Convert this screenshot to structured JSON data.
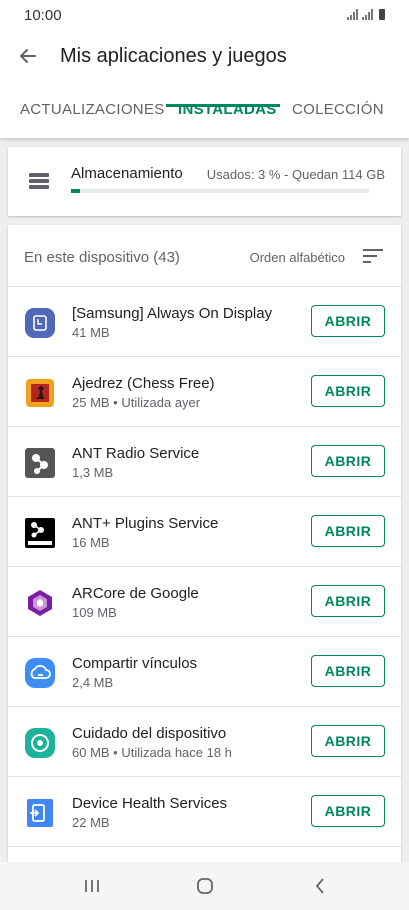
{
  "status_bar": {
    "time": "10:00"
  },
  "header": {
    "title": "Mis aplicaciones y juegos",
    "tabs": [
      {
        "label": "ACTUALIZACIONES",
        "active": false
      },
      {
        "label": "INSTALADAS",
        "active": true
      },
      {
        "label": "COLECCIÓN",
        "active": false
      }
    ]
  },
  "storage": {
    "title": "Almacenamiento",
    "usage_text": "Usados: 3 % - Quedan 114 GB",
    "used_fraction": 0.03
  },
  "list": {
    "title": "En este dispositivo (43)",
    "sort_label": "Orden alfabético",
    "button_label": "ABRIR",
    "apps": [
      {
        "name": "[Samsung] Always On Display",
        "meta": "41 MB",
        "icon": "samsung-aod-icon"
      },
      {
        "name": "Ajedrez (Chess Free)",
        "meta": "25 MB • Utilizada ayer",
        "icon": "chess-icon"
      },
      {
        "name": "ANT Radio Service",
        "meta": "1,3 MB",
        "icon": "ant-radio-icon"
      },
      {
        "name": "ANT+ Plugins Service",
        "meta": "16 MB",
        "icon": "ant-plus-icon"
      },
      {
        "name": "ARCore de Google",
        "meta": "109 MB",
        "icon": "arcore-icon"
      },
      {
        "name": "Compartir vínculos",
        "meta": "2,4 MB",
        "icon": "link-sharing-icon"
      },
      {
        "name": "Cuidado del dispositivo",
        "meta": "60 MB • Utilizada hace 18 h",
        "icon": "device-care-icon"
      },
      {
        "name": "Device Health Services",
        "meta": "22 MB",
        "icon": "device-health-icon"
      }
    ]
  },
  "colors": {
    "accent": "#01875f",
    "text_primary": "#202124",
    "text_secondary": "#5f6368"
  }
}
